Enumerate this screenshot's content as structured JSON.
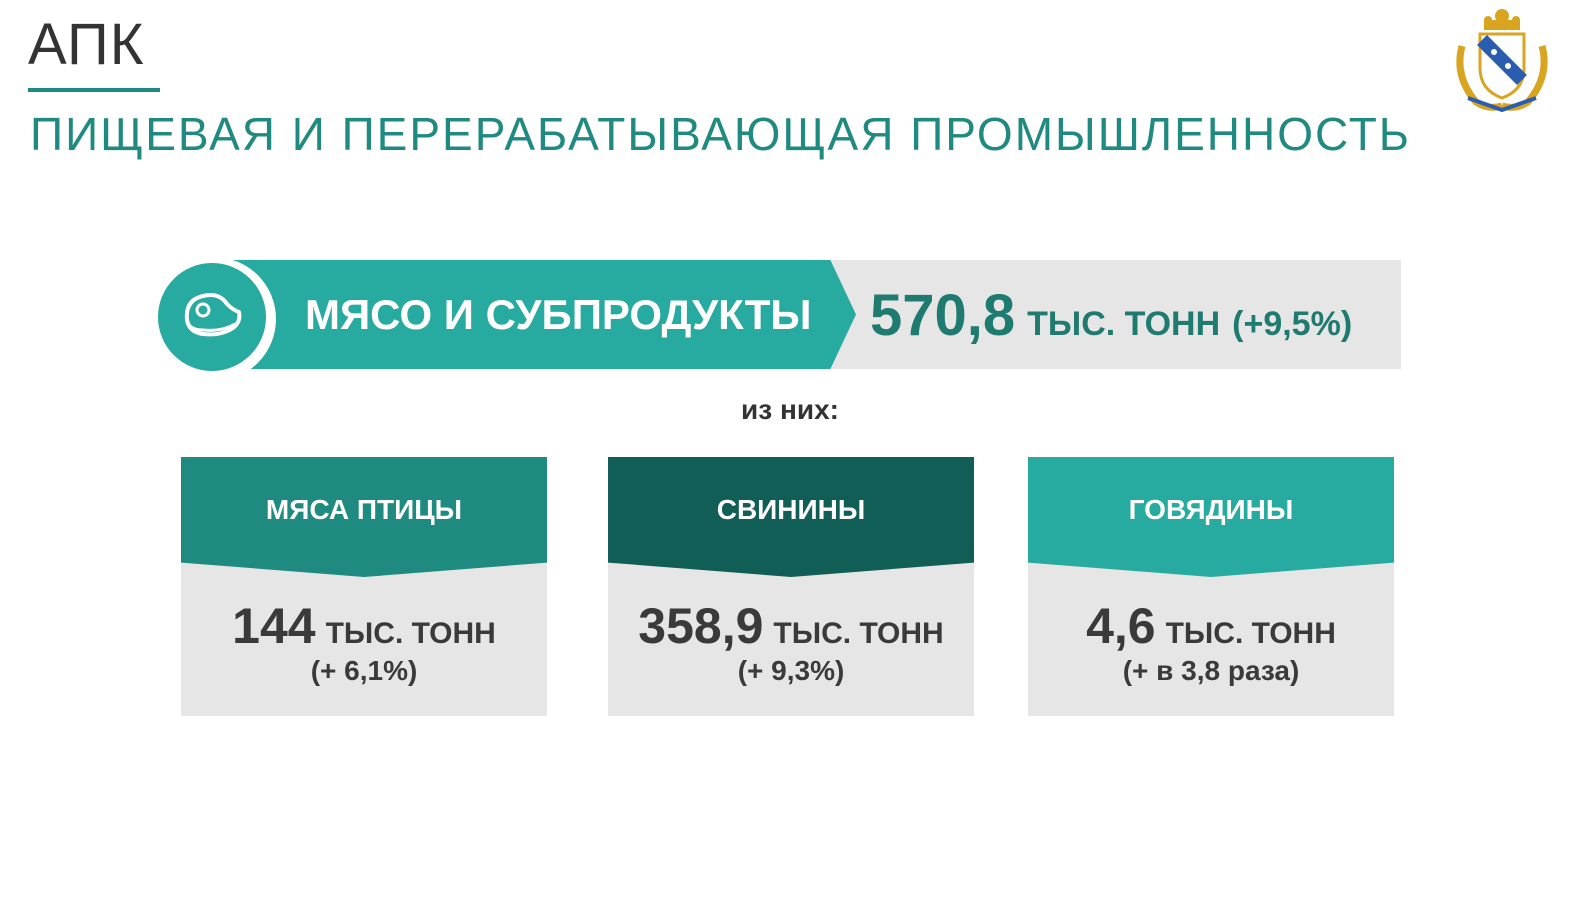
{
  "header": {
    "section": "АПК",
    "title": "ПИЩЕВАЯ И ПЕРЕРАБАТЫВАЮЩАЯ ПРОМЫШЛЕННОСТЬ"
  },
  "emblem": {
    "icon": "coat-of-arms-icon"
  },
  "banner": {
    "icon": "meat-steak-icon",
    "label": "МЯСО И СУБПРОДУКТЫ",
    "value": "570,8",
    "unit": "ТЫС. ТОНН",
    "change": "(+9,5%)"
  },
  "of_them": "из них:",
  "cards": [
    {
      "label": "МЯСА ПТИЦЫ",
      "value": "144",
      "unit": "ТЫС. ТОНН",
      "change": "(+ 6,1%)",
      "color": "#1f8a80"
    },
    {
      "label": "СВИНИНЫ",
      "value": "358,9",
      "unit": "ТЫС. ТОНН",
      "change": "(+ 9,3%)",
      "color": "#115e56"
    },
    {
      "label": "ГОВЯДИНЫ",
      "value": "4,6",
      "unit": "ТЫС. ТОНН",
      "change": "(+ в 3,8 раза)",
      "color": "#27aa9f"
    }
  ],
  "colors": {
    "accent": "#1f8a80",
    "banner": "#27aa9f",
    "panel": "#e6e6e6"
  }
}
